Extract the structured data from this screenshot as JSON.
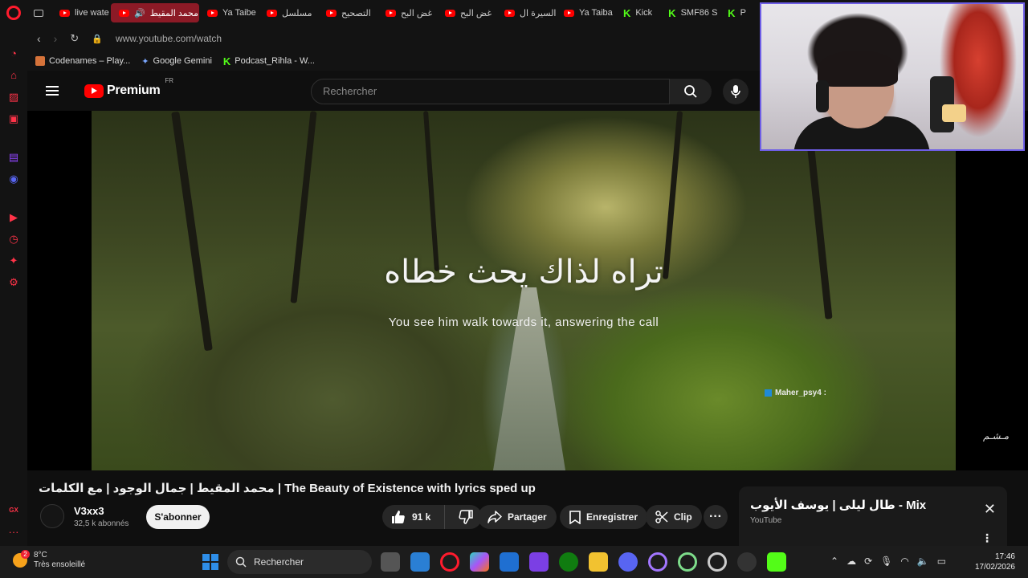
{
  "tabs": [
    {
      "label": "live wate",
      "icon": "youtube-icon"
    },
    {
      "label": "محمد المقيط",
      "icon": "youtube-icon",
      "active": true
    },
    {
      "label": "Ya Taibe",
      "icon": "youtube-icon"
    },
    {
      "label": "مسلسل",
      "icon": "youtube-icon"
    },
    {
      "label": "التصحيح",
      "icon": "youtube-icon"
    },
    {
      "label": "غض البح",
      "icon": "youtube-icon"
    },
    {
      "label": "غض البح",
      "icon": "youtube-icon"
    },
    {
      "label": "السيرة ال",
      "icon": "youtube-icon"
    },
    {
      "label": "Ya Taiba",
      "icon": "youtube-icon"
    },
    {
      "label": "Kick",
      "icon": "kick-icon"
    },
    {
      "label": "SMF86 S",
      "icon": "kick-icon"
    },
    {
      "label": "P",
      "icon": "kick-icon"
    }
  ],
  "address": {
    "url": "www.youtube.com/watch"
  },
  "bookmarks": [
    {
      "label": "Codenames – Play...",
      "icon": "codenames-icon"
    },
    {
      "label": "Google Gemini",
      "icon": "gemini-icon"
    },
    {
      "label": "Podcast_Rihla - W...",
      "icon": "kick-icon"
    }
  ],
  "youtube": {
    "logo_text": "Premium",
    "country": "FR",
    "search_placeholder": "Rechercher"
  },
  "video": {
    "lyric_ar": "تراه لذاك يحث خطاه",
    "lyric_en": "You see him walk towards it, answering the call",
    "chat_user": "Maher_psy4 :",
    "watermark": "مـشـم"
  },
  "meta": {
    "title": "محمد المقيط | جمال الوجود | مع الكلمات | The Beauty of Existence with lyrics sped up",
    "channel": "V3xx3",
    "subscribers": "32,5 k abonnés",
    "subscribe": "S'abonner",
    "likes": "91 k",
    "share": "Partager",
    "save": "Enregistrer",
    "clip": "Clip"
  },
  "mix": {
    "title": "طال ليلى | يوسف الأيوب - Mix",
    "subtitle": "YouTube"
  },
  "taskbar": {
    "temperature": "8°C",
    "weather": "Très ensoleillé",
    "notifications": "2",
    "search": "Rechercher",
    "time": "17:46",
    "date": "17/02/2026"
  },
  "sidebar_label": "GX",
  "colors": {
    "accent": "#ff1b2d",
    "youtube_red": "#ff0000",
    "kick_green": "#53fc18",
    "webcam_border": "#6e5ee6"
  }
}
